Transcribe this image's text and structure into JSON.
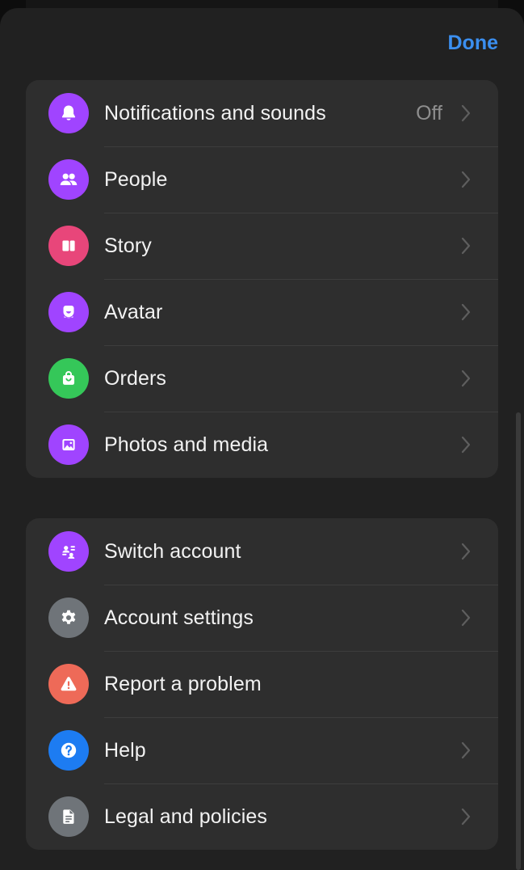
{
  "header": {
    "done_label": "Done"
  },
  "colors": {
    "accent": "#3b8ff0",
    "purple": "#a044ff",
    "pink": "#e8467a",
    "green": "#35c759",
    "gray": "#6f7479",
    "coral": "#ee6a58",
    "blue": "#1d7cf2"
  },
  "groups": [
    {
      "items": [
        {
          "label": "Notifications and sounds",
          "value": "Off",
          "icon": "bell-icon"
        },
        {
          "label": "People",
          "value": "",
          "icon": "people-icon"
        },
        {
          "label": "Story",
          "value": "",
          "icon": "story-icon"
        },
        {
          "label": "Avatar",
          "value": "",
          "icon": "avatar-icon"
        },
        {
          "label": "Orders",
          "value": "",
          "icon": "shopping-bag-icon"
        },
        {
          "label": "Photos and media",
          "value": "",
          "icon": "photo-icon"
        }
      ]
    },
    {
      "items": [
        {
          "label": "Switch account",
          "value": "",
          "icon": "switch-account-icon"
        },
        {
          "label": "Account settings",
          "value": "",
          "icon": "gear-icon"
        },
        {
          "label": "Report a problem",
          "value": "",
          "icon": "warning-icon"
        },
        {
          "label": "Help",
          "value": "",
          "icon": "help-icon"
        },
        {
          "label": "Legal and policies",
          "value": "",
          "icon": "document-icon"
        }
      ]
    }
  ]
}
